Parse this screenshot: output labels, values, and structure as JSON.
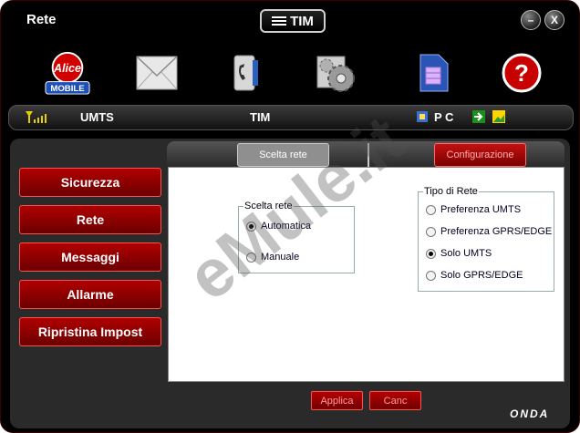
{
  "window": {
    "title": "Rete",
    "logo": "TIM",
    "brand": "ONDA"
  },
  "window_controls": {
    "minimize": "–",
    "close": "X"
  },
  "toolbar": {
    "items": [
      {
        "name": "alice-mobile-icon",
        "label": "Alice",
        "sublabel": "MOBILE"
      },
      {
        "name": "envelope-icon"
      },
      {
        "name": "phone-icon"
      },
      {
        "name": "settings-gear-icon"
      },
      {
        "name": "sim-card-icon"
      },
      {
        "name": "help-icon",
        "label": "?"
      }
    ]
  },
  "status": {
    "network_type": "UMTS",
    "operator": "TIM",
    "pc_label": "P C"
  },
  "tabs": [
    {
      "label": "Scelta rete"
    },
    {
      "label": "Configurazione"
    }
  ],
  "sidebar": {
    "items": [
      {
        "label": "Sicurezza"
      },
      {
        "label": "Rete"
      },
      {
        "label": "Messaggi"
      },
      {
        "label": "Allarme"
      },
      {
        "label": "Ripristina Impost"
      }
    ]
  },
  "scelta_rete": {
    "legend": "Scelta rete",
    "options": [
      {
        "label": "Automatica",
        "selected": true
      },
      {
        "label": "Manuale",
        "selected": false
      }
    ]
  },
  "tipo_di_rete": {
    "legend": "Tipo di Rete",
    "options": [
      {
        "label": "Preferenza UMTS",
        "selected": false
      },
      {
        "label": "Preferenza GPRS/EDGE",
        "selected": false
      },
      {
        "label": "Solo UMTS",
        "selected": true
      },
      {
        "label": "Solo GPRS/EDGE",
        "selected": false
      }
    ]
  },
  "buttons": {
    "apply": "Applica",
    "cancel": "Canc"
  },
  "watermark": "eMule.it",
  "colors": {
    "accent_red": "#b00000",
    "frame": "#000000",
    "panel": "#2a2a2a"
  }
}
